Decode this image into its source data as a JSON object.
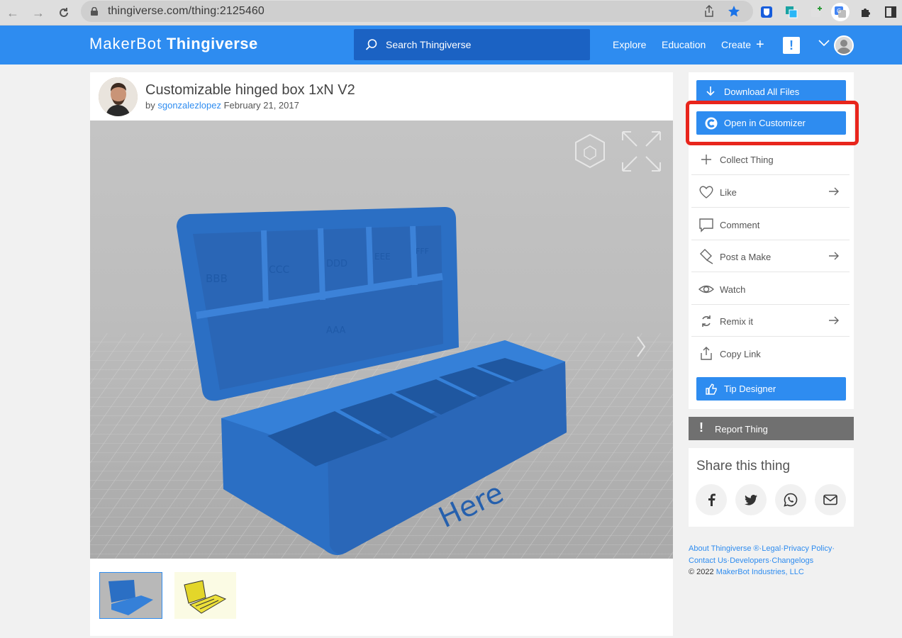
{
  "browser": {
    "url": "thingiverse.com/thing:2125460"
  },
  "header": {
    "brand_left": "MakerBot",
    "brand_right": "Thingiverse",
    "search_placeholder": "Search Thingiverse",
    "nav": [
      "Explore",
      "Education",
      "Create"
    ],
    "notification_glyph": "!"
  },
  "thing": {
    "title": "Customizable hinged box 1xN V2",
    "by_prefix": "by",
    "author": "sgonzalezlopez",
    "date": "February 21, 2017",
    "model_labels": [
      "BBB",
      "CCC",
      "DDD",
      "EEE",
      "FFF",
      "AAA",
      "Here"
    ]
  },
  "sidebar": {
    "download_label": "Download All Files",
    "customizer_label": "Open in Customizer",
    "actions": [
      "Collect Thing",
      "Like",
      "Comment",
      "Post a Make",
      "Watch",
      "Remix it",
      "Copy Link"
    ],
    "tip_label": "Tip Designer",
    "report_label": "Report Thing"
  },
  "share": {
    "title": "Share this thing",
    "networks": [
      "facebook-icon",
      "twitter-icon",
      "whatsapp-icon",
      "email-icon"
    ]
  },
  "footer": {
    "links_line1": "About Thingiverse ®·Legal·Privacy Policy·",
    "links_line2": "Contact Us·Developers·Changelogs",
    "copyright_prefix": "©  2022",
    "company": "MakerBot Industries, LLC"
  },
  "colors": {
    "brand_blue": "#2e8cf0",
    "highlight_red": "#e8251c",
    "model_blue": "#2b6fc4"
  }
}
